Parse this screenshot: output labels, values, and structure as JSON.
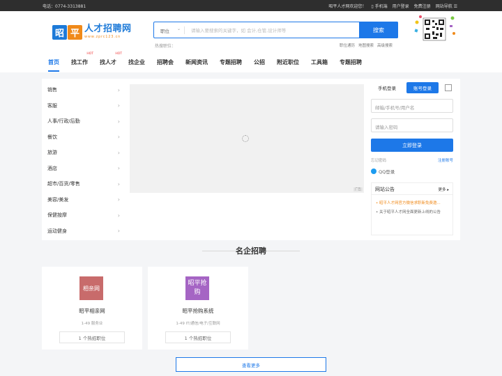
{
  "topbar": {
    "phone": "电话：0774-3313881",
    "welcome": "昭平人才网欢迎您！",
    "mobile": "手机端",
    "login": "用户登录",
    "register": "免费注册",
    "sitenav": "网站导航"
  },
  "logo": {
    "char1": "昭",
    "char2": "平",
    "title": "人才招聘网",
    "url": "www.zprc123.cn"
  },
  "search": {
    "category": "职位",
    "placeholder": "请输入要搜索的关键字，如 会计,仓管,设计师等",
    "button": "搜索",
    "hot_label": "热搜职位：",
    "links": [
      "职位通历",
      "地图搜索",
      "高级搜索"
    ]
  },
  "nav": {
    "items": [
      {
        "label": "首页",
        "hot": ""
      },
      {
        "label": "找工作",
        "hot": "HOT"
      },
      {
        "label": "找人才",
        "hot": "HOT"
      },
      {
        "label": "找企业",
        "hot": ""
      },
      {
        "label": "招聘会",
        "hot": ""
      },
      {
        "label": "新闻资讯",
        "hot": ""
      },
      {
        "label": "专题招聘",
        "hot": ""
      },
      {
        "label": "公招",
        "hot": ""
      },
      {
        "label": "附近职位",
        "hot": ""
      },
      {
        "label": "工具箱",
        "hot": ""
      },
      {
        "label": "专题招聘",
        "hot": ""
      }
    ]
  },
  "categories": [
    "销售",
    "客服",
    "人事/行政/后勤",
    "餐饮",
    "旅游",
    "酒店",
    "超市/百货/零售",
    "美容/美发",
    "保健按摩",
    "运动健身"
  ],
  "banner": {
    "ad": "广告"
  },
  "login": {
    "tab_phone": "手机登录",
    "tab_account": "账号登录",
    "username_placeholder": "邮箱/手机号/用户名",
    "password_placeholder": "请输入密码",
    "button": "立即登录",
    "forgot": "忘记密码",
    "register": "注册账号",
    "qq": "QQ登录"
  },
  "notice": {
    "title": "网站公告",
    "more": "更多",
    "items": [
      "昭平人才网官方微信求职新免费邀...",
      "关于昭平人才网全面更新上线的公告"
    ]
  },
  "section": {
    "title": "名企招聘"
  },
  "companies": [
    {
      "logo_text": "相亲网",
      "name": "昭平相亲网",
      "meta": "1-49    服务业",
      "jobs": "1 个热招职位"
    },
    {
      "logo_text": "昭平抢购",
      "name": "昭平抢购系统",
      "meta": "1-49    IT/通信/电子/互联网",
      "jobs": "1 个热招职位"
    }
  ],
  "view_more": "查看更多",
  "colors": {
    "primary": "#1d78e8",
    "accent": "#f08a1a",
    "logo1": "#c86b6b",
    "logo2": "#a565c4"
  }
}
